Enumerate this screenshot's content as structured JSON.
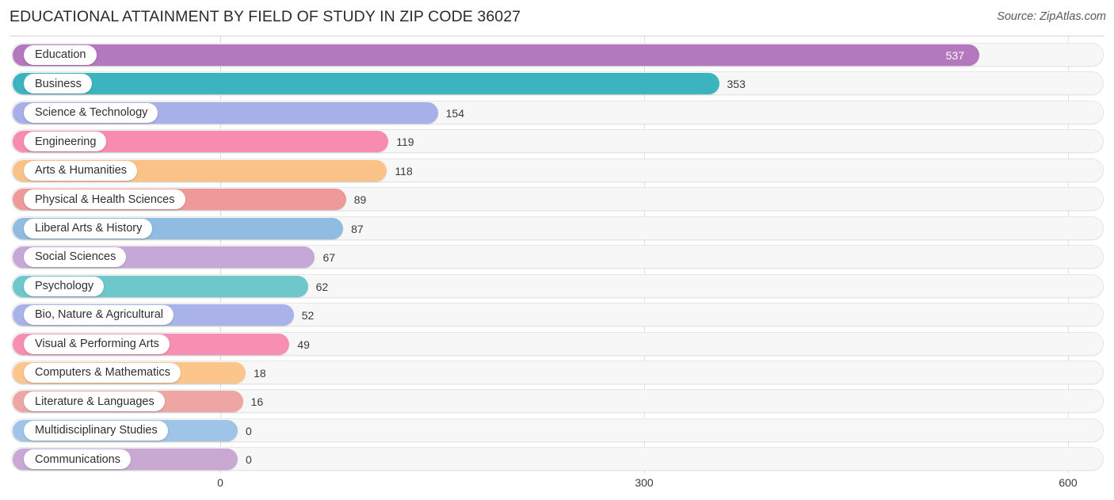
{
  "header": {
    "title": "EDUCATIONAL ATTAINMENT BY FIELD OF STUDY IN ZIP CODE 36027",
    "source": "Source: ZipAtlas.com"
  },
  "chart_data": {
    "type": "bar",
    "orientation": "horizontal",
    "title": "EDUCATIONAL ATTAINMENT BY FIELD OF STUDY IN ZIP CODE 36027",
    "subtitle": "",
    "xlabel": "",
    "ylabel": "",
    "xlim": [
      0,
      600
    ],
    "ticks": [
      "0",
      "300",
      "600"
    ],
    "tick_values": [
      0,
      300,
      600
    ],
    "grid": true,
    "legend": null,
    "categories": [
      "Education",
      "Business",
      "Science & Technology",
      "Engineering",
      "Arts & Humanities",
      "Physical & Health Sciences",
      "Liberal Arts & History",
      "Social Sciences",
      "Psychology",
      "Bio, Nature & Agricultural",
      "Visual & Performing Arts",
      "Computers & Mathematics",
      "Literature & Languages",
      "Multidisciplinary Studies",
      "Communications"
    ],
    "values": [
      537,
      353,
      154,
      119,
      118,
      89,
      87,
      67,
      62,
      52,
      49,
      18,
      16,
      0,
      0
    ],
    "value_labels": [
      "537",
      "353",
      "154",
      "119",
      "118",
      "89",
      "87",
      "67",
      "62",
      "52",
      "49",
      "18",
      "16",
      "0",
      "0"
    ],
    "colors": [
      "#b munge"
    ]
  },
  "bars": [
    {
      "label": "Education",
      "value": 537,
      "value_label": "537",
      "color": "#b378bd",
      "inside": true
    },
    {
      "label": "Business",
      "value": 353,
      "value_label": "353",
      "color": "#3cb4bf",
      "inside": false
    },
    {
      "label": "Science & Technology",
      "value": 154,
      "value_label": "154",
      "color": "#a7b0e8",
      "inside": false
    },
    {
      "label": "Engineering",
      "value": 119,
      "value_label": "119",
      "color": "#f88bb0",
      "inside": false
    },
    {
      "label": "Arts & Humanities",
      "value": 118,
      "value_label": "118",
      "color": "#fbc287",
      "inside": false
    },
    {
      "label": "Physical & Health Sciences",
      "value": 89,
      "value_label": "89",
      "color": "#ef9a9a",
      "inside": false
    },
    {
      "label": "Liberal Arts & History",
      "value": 87,
      "value_label": "87",
      "color": "#8fbce0",
      "inside": false
    },
    {
      "label": "Social Sciences",
      "value": 67,
      "value_label": "67",
      "color": "#c6a8d8",
      "inside": false
    },
    {
      "label": "Psychology",
      "value": 62,
      "value_label": "62",
      "color": "#6ec7cb",
      "inside": false
    },
    {
      "label": "Bio, Nature & Agricultural",
      "value": 52,
      "value_label": "52",
      "color": "#aab3e9",
      "inside": false
    },
    {
      "label": "Visual & Performing Arts",
      "value": 49,
      "value_label": "49",
      "color": "#f78fb3",
      "inside": false
    },
    {
      "label": "Computers & Mathematics",
      "value": 18,
      "value_label": "18",
      "color": "#fbc58c",
      "inside": false
    },
    {
      "label": "Literature & Languages",
      "value": 16,
      "value_label": "16",
      "color": "#eda6a3",
      "inside": false
    },
    {
      "label": "Multidisciplinary Studies",
      "value": 0,
      "value_label": "0",
      "color": "#9ec5e8",
      "inside": false
    },
    {
      "label": "Communications",
      "value": 0,
      "value_label": "0",
      "color": "#c9a9d4",
      "inside": false
    }
  ],
  "axis": {
    "ticks": [
      {
        "label": "0",
        "value": 0
      },
      {
        "label": "300",
        "value": 300
      },
      {
        "label": "600",
        "value": 600
      }
    ]
  }
}
